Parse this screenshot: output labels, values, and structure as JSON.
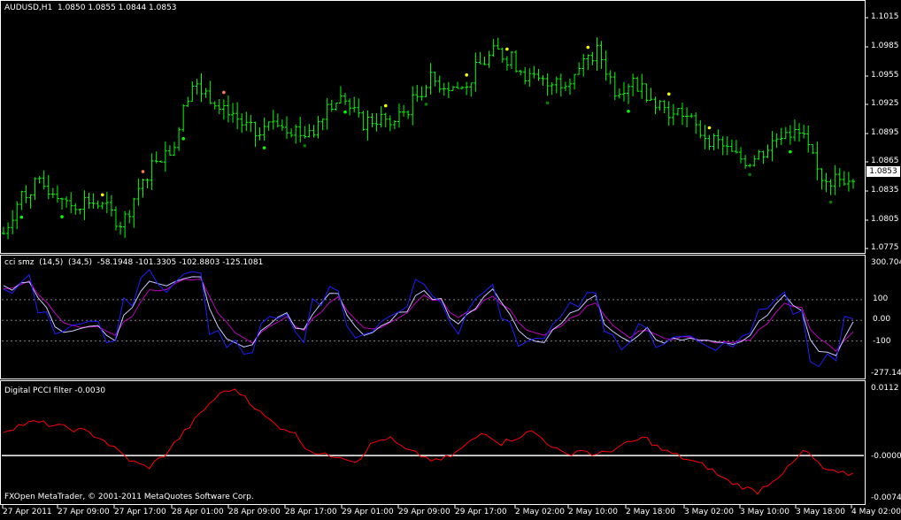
{
  "main_pane": {
    "title": "AUDUSD,H1  1.0850 1.0855 1.0844 1.0853",
    "current_price": "1.0853",
    "y_labels": [
      "1.1015",
      "1.0985",
      "1.0955",
      "1.0925",
      "1.0895",
      "1.0865",
      "1.0835",
      "1.0805",
      "1.0775"
    ]
  },
  "cci_pane": {
    "title": "cci smz  (14,5)  (34,5)  -58.1948 -101.3305 -102.8803 -125.1081",
    "y_labels": [
      "300.704",
      "100",
      "0.00",
      "-100",
      "-277.141"
    ]
  },
  "pcci_pane": {
    "title": "Digital PCCI filter -0.0030",
    "y_labels": [
      "0.0112",
      "-0.0000",
      "-0.0074"
    ]
  },
  "time_axis": {
    "labels": [
      "27 Apr 2011",
      "27 Apr 09:00",
      "27 Apr 17:00",
      "28 Apr 01:00",
      "28 Apr 09:00",
      "28 Apr 17:00",
      "29 Apr 01:00",
      "29 Apr 09:00",
      "29 Apr 17:00",
      "2 May 02:00",
      "2 May 10:00",
      "2 May 18:00",
      "3 May 02:00",
      "3 May 10:00",
      "3 May 18:00",
      "4 May 02:00"
    ]
  },
  "copyright": "FXOpen MetaTrader, © 2001-2011 MetaQuotes Software Corp.",
  "colors": {
    "background": "#000000",
    "bars": "#00ff00",
    "frame": "#ffffff",
    "cci_fast": "#1e1eff",
    "cci_slow": "#c000c0",
    "cci_signal": "#c8c8ff",
    "pcci": "#ff0000"
  },
  "chart_data": [
    {
      "type": "ohlc",
      "title": "AUDUSD,H1  1.0850 1.0855 1.0844 1.0853",
      "ylim": [
        1.077,
        1.1025
      ],
      "x": [
        "27 Apr 2011",
        "27 Apr 09:00",
        "27 Apr 17:00",
        "28 Apr 01:00",
        "28 Apr 09:00",
        "28 Apr 17:00",
        "29 Apr 01:00",
        "29 Apr 09:00",
        "29 Apr 17:00",
        "2 May 02:00",
        "2 May 10:00",
        "2 May 18:00",
        "3 May 02:00",
        "3 May 10:00",
        "3 May 18:00",
        "4 May 02:00"
      ],
      "close_path": [
        1.079,
        1.083,
        1.084,
        1.0835,
        1.082,
        1.0825,
        1.0815,
        1.08,
        1.084,
        1.087,
        1.088,
        1.0945,
        1.0935,
        1.0925,
        1.0905,
        1.089,
        1.091,
        1.09,
        1.089,
        1.0925,
        1.093,
        1.0905,
        1.091,
        1.0905,
        1.0925,
        1.095,
        1.0945,
        1.094,
        1.0965,
        1.098,
        1.097,
        1.095,
        1.0945,
        1.095,
        1.0965,
        1.098,
        1.094,
        1.095,
        1.0935,
        1.092,
        1.0915,
        1.0895,
        1.0885,
        1.087,
        1.0865,
        1.088,
        1.09,
        1.089,
        1.085,
        1.0845,
        1.0853
      ]
    },
    {
      "type": "line",
      "title": "cci smz  (14,5)  (34,5)  -58.1948 -101.3305 -102.8803 -125.1081",
      "ylim": [
        -277.141,
        300.704
      ],
      "levels": [
        100,
        0,
        -100
      ]
    },
    {
      "type": "line",
      "title": "Digital PCCI filter -0.0030",
      "ylim": [
        -0.0074,
        0.0112
      ],
      "levels": [
        0
      ],
      "series": [
        {
          "values": [
            0.004,
            0.005,
            0.0055,
            0.005,
            0.0045,
            0.004,
            0.003,
            0.001,
            -0.001,
            -0.002,
            0.0,
            0.003,
            0.006,
            0.009,
            0.011,
            0.01,
            0.007,
            0.005,
            0.004,
            0.001,
            0.0,
            0.0,
            -0.001,
            0.002,
            0.003,
            0.001,
            0.0,
            -0.001,
            0.0,
            0.002,
            0.004,
            0.002,
            0.003,
            0.004,
            0.002,
            0.0,
            0.001,
            0.0,
            0.001,
            0.002,
            0.003,
            0.001,
            0.0,
            -0.001,
            -0.002,
            -0.004,
            -0.005,
            -0.006,
            -0.004,
            -0.002,
            0.001,
            -0.002,
            -0.003,
            -0.003
          ]
        }
      ]
    }
  ]
}
